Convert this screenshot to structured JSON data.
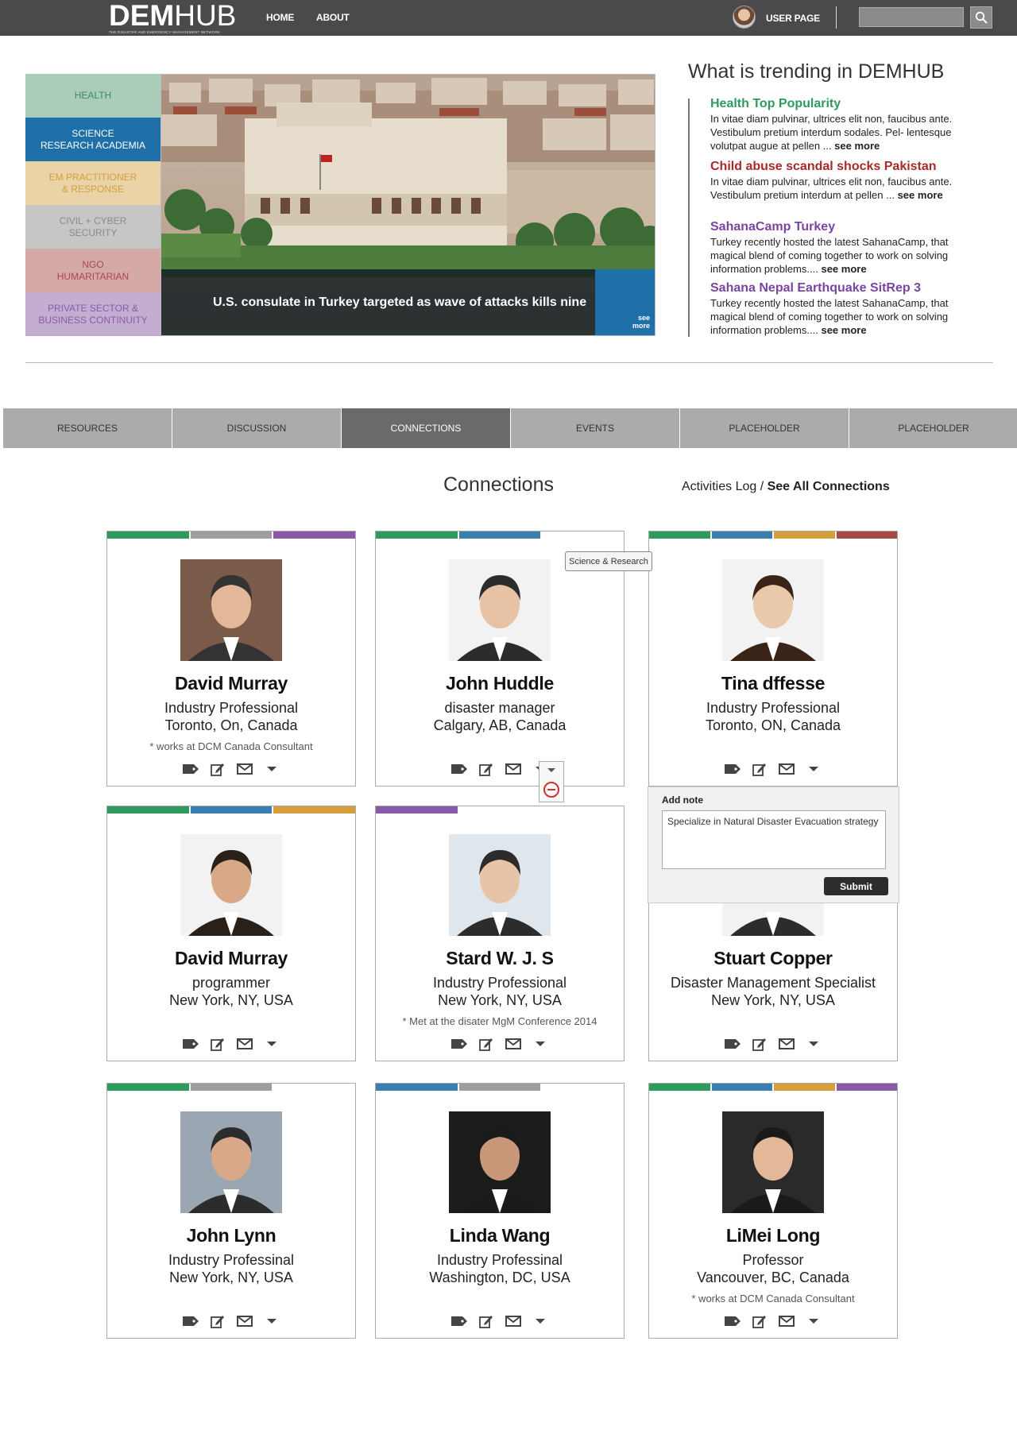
{
  "header": {
    "logo_bold": "DEM",
    "logo_light": "HUB",
    "logo_tagline": "THE DISASTER AND EMERGENCY MANAGEMENT NETWORK",
    "nav": [
      "HOME",
      "ABOUT"
    ],
    "user_link": "USER PAGE",
    "search_placeholder": ""
  },
  "hero": {
    "categories": [
      {
        "label": "HEALTH",
        "bg": "#a9cdb9",
        "fg": "#3d8a62"
      },
      {
        "label": "SCIENCE\nRESEARCH ACADEMIA",
        "bg": "#1f6fa8",
        "fg": "#ffffff"
      },
      {
        "label": "EM PRACTITIONER\n& RESPONSE",
        "bg": "#ead3a6",
        "fg": "#d59f3d"
      },
      {
        "label": "CIVIL + CYBER\nSECURITY",
        "bg": "#c6c6c6",
        "fg": "#8a8a8a"
      },
      {
        "label": "NGO\nHUMARITARIAN",
        "bg": "#d6a9a9",
        "fg": "#a94848"
      },
      {
        "label": "PRIVATE SECTOR &\nBUSINESS CONTINUITY",
        "bg": "#c3aed2",
        "fg": "#8a5aa9"
      }
    ],
    "caption": "U.S. consulate in Turkey targeted as wave of attacks kills nine",
    "see_more": "see\nmore"
  },
  "trending": {
    "title": "What is trending in DEMHUB",
    "items": [
      {
        "title": "Health Top Popularity",
        "color": "#2e9a5e",
        "body": "In vitae diam pulvinar, ultrices elit non, faucibus ante. Vestibulum pretium interdum sodales. Pel- lentesque volutpat augue at pellen ...",
        "more": "see more"
      },
      {
        "title": "Child abuse scandal shocks Pakistan",
        "color": "#a72a2a",
        "body": "In vitae diam pulvinar, ultrices elit non, faucibus ante. Vestibulum pretium interdum at pellen ...",
        "more": "see more"
      },
      {
        "title": "SahanaCamp Turkey",
        "color": "#7a44a3",
        "body": "Turkey recently hosted the latest SahanaCamp, that magical blend of coming together to work on solving information problems....",
        "more": "see more"
      },
      {
        "title": "Sahana Nepal Earthquake SitRep 3",
        "color": "#7a44a3",
        "body": "Turkey recently hosted the latest SahanaCamp, that magical blend of coming together to work on solving information problems....",
        "more": "see more"
      }
    ]
  },
  "tabs": [
    {
      "label": "RESOURCES",
      "active": false
    },
    {
      "label": "DISCUSSION",
      "active": false
    },
    {
      "label": "CONNECTIONS",
      "active": true
    },
    {
      "label": "EVENTS",
      "active": false
    },
    {
      "label": "PLACEHOLDER",
      "active": false
    },
    {
      "label": "PLACEHOLDER",
      "active": false
    }
  ],
  "connections": {
    "title": "Connections",
    "activities_log": "Activities Log / ",
    "see_all": "See All Connections",
    "tooltip": "Science & Research",
    "note": {
      "label": "Add note",
      "value": "Specialize in Natural Disaster Evacuation strategy",
      "submit": "Submit"
    },
    "cards": [
      {
        "name": "David Murray",
        "role": "Industry Professional",
        "loc": "Toronto, On, Canada",
        "note": "* works at DCM Canada Consultant",
        "bars": [
          "#2e9a5e",
          "#9e9e9e",
          "#8a5aa9"
        ]
      },
      {
        "name": "John Huddle",
        "role": "disaster manager",
        "loc": "Calgary, AB, Canada",
        "note": "",
        "bars": [
          "#2e9a5e",
          "#3a7fb0"
        ]
      },
      {
        "name": "Tina dffesse",
        "role": "Industry Professional",
        "loc": "Toronto, ON, Canada",
        "note": "",
        "bars": [
          "#2e9a5e",
          "#3a7fb0",
          "#d59f3d",
          "#a94848"
        ]
      },
      {
        "name": "David Murray",
        "role": "programmer",
        "loc": "New York, NY, USA",
        "note": "",
        "bars": [
          "#2e9a5e",
          "#3a7fb0",
          "#d59f3d"
        ]
      },
      {
        "name": "Stard W. J. S",
        "role": "Industry Professional",
        "loc": "New York, NY, USA",
        "note": "* Met at the disater MgM Conference 2014",
        "bars": [
          "#8a5aa9"
        ]
      },
      {
        "name": "Stuart Copper",
        "role": "Disaster Management Specialist",
        "loc": "New York, NY, USA",
        "note": "",
        "bars": [
          "#2e9a5e"
        ]
      },
      {
        "name": "John Lynn",
        "role": "Industry Professinal",
        "loc": "New York, NY, USA",
        "note": "",
        "bars": [
          "#2e9a5e",
          "#9e9e9e"
        ]
      },
      {
        "name": "Linda Wang",
        "role": "Industry Professinal",
        "loc": "Washington, DC, USA",
        "note": "",
        "bars": [
          "#3a7fb0",
          "#9e9e9e"
        ]
      },
      {
        "name": "LiMei Long",
        "role": "Professor",
        "loc": "Vancouver, BC, Canada",
        "note": "* works at DCM Canada Consultant",
        "bars": [
          "#2e9a5e",
          "#3a7fb0",
          "#d59f3d",
          "#8a5aa9"
        ]
      }
    ]
  }
}
